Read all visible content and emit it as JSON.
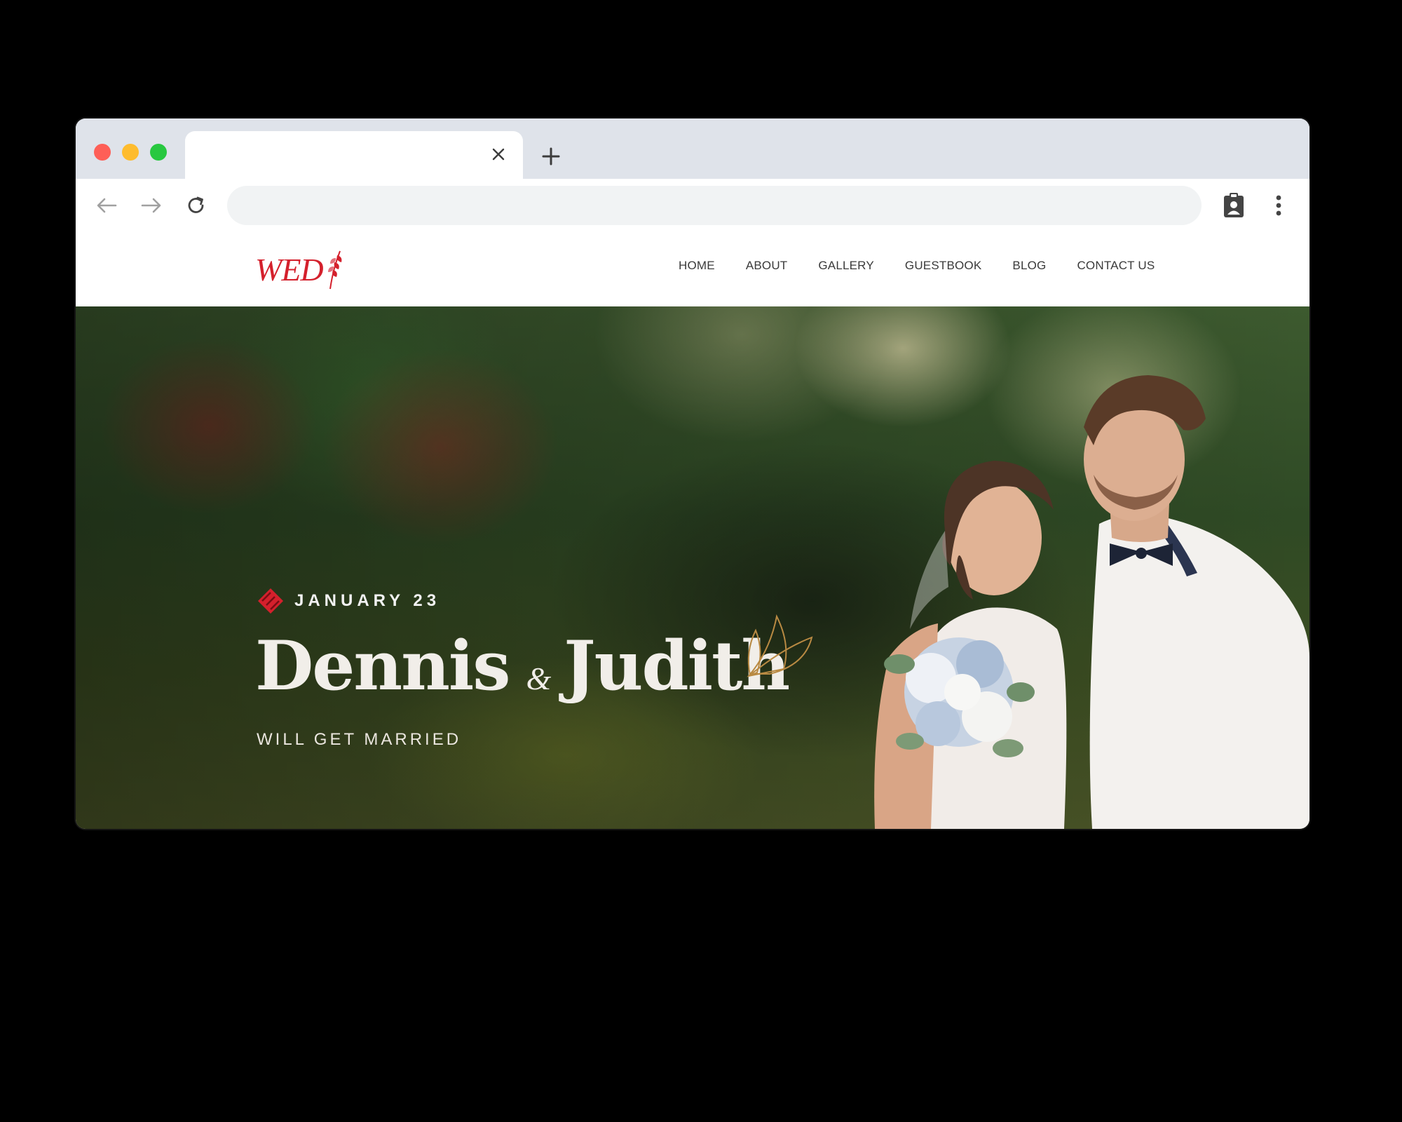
{
  "browser": {
    "tab": {
      "title": ""
    },
    "address": {
      "value": ""
    },
    "icons": {
      "close": "close-icon",
      "new_tab": "plus-icon",
      "back": "back-arrow-icon",
      "forward": "forward-arrow-icon",
      "reload": "reload-icon",
      "profile": "clipboard-account-icon",
      "menu": "kebab-menu-icon"
    }
  },
  "site": {
    "logo": "WED",
    "nav": [
      "HOME",
      "ABOUT",
      "GALLERY",
      "GUESTBOOK",
      "BLOG",
      "CONTACT US"
    ]
  },
  "hero": {
    "date": "JANUARY 23",
    "name_1": "Dennis",
    "ampersand": "&",
    "name_2": "Judith",
    "subtitle": "WILL GET MARRIED"
  },
  "colors": {
    "brand": "#d4202c",
    "accent_gold": "#b98a43"
  }
}
